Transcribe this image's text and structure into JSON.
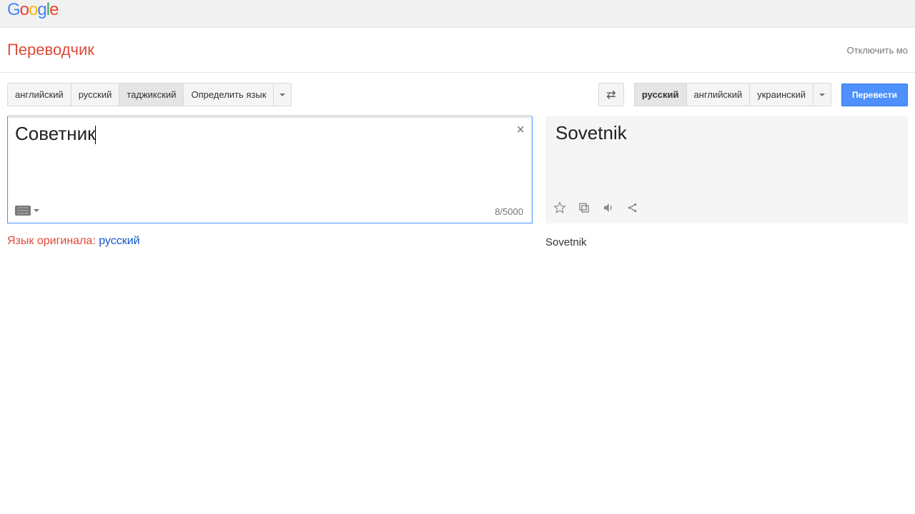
{
  "logo": {
    "text": "Google"
  },
  "app": {
    "title": "Переводчик",
    "instant_off": "Отключить мо"
  },
  "source_langs": {
    "items": [
      "английский",
      "русский",
      "таджикский"
    ],
    "detect": "Определить язык",
    "selected_index": 2
  },
  "target_langs": {
    "items": [
      "русский",
      "английский",
      "украинский"
    ],
    "selected_index": 0
  },
  "translate_button": "Перевести",
  "source": {
    "text": "Советник",
    "char_count": "8/5000"
  },
  "target": {
    "text": "Sovetnik",
    "transliteration": "Sovetnik"
  },
  "detected": {
    "label": "Язык оригинала: ",
    "lang": "русский"
  }
}
